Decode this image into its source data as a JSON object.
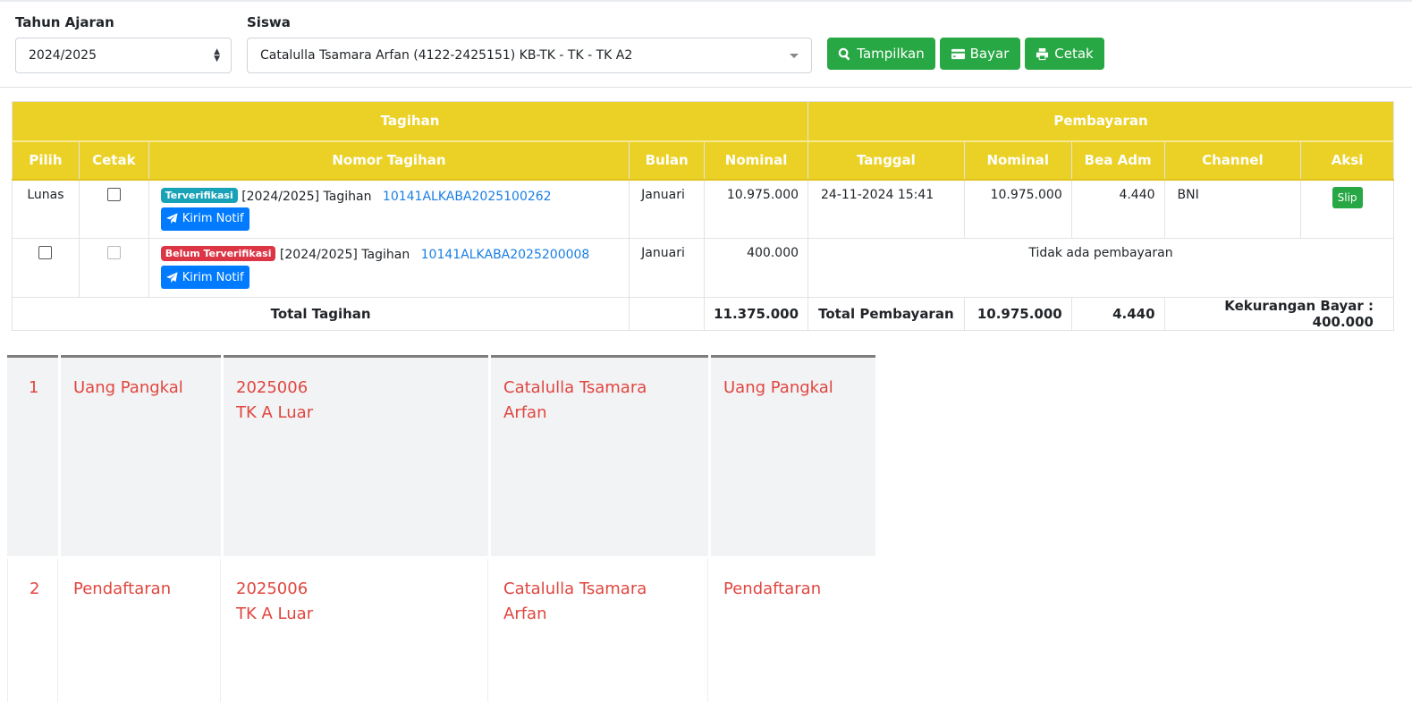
{
  "filter": {
    "year_label": "Tahun Ajaran",
    "year_value": "2024/2025",
    "student_label": "Siswa",
    "student_value": "Catalulla Tsamara Arfan (4122-2425151) KB-TK - TK - TK A2",
    "buttons": {
      "show": "Tampilkan",
      "pay": "Bayar",
      "print": "Cetak"
    }
  },
  "table": {
    "group_headers": {
      "billing": "Tagihan",
      "payment": "Pembayaran"
    },
    "columns": [
      "Pilih",
      "Cetak",
      "Nomor Tagihan",
      "Bulan",
      "Nominal",
      "Tanggal",
      "Nominal",
      "Bea Adm",
      "Channel",
      "Aksi"
    ],
    "rows": [
      {
        "pilih": "Lunas",
        "badge": "Terverifikasi",
        "desc": "[2024/2025] Tagihan",
        "number": "10141ALKABA2025100262",
        "notify": "Kirim Notif",
        "month": "Januari",
        "nominal": "10.975.000",
        "date": "24-11-2024 15:41",
        "paid": "10.975.000",
        "fee": "4.440",
        "channel": "BNI",
        "action": "Slip"
      },
      {
        "badge": "Belum Terverifikasi",
        "desc": "[2024/2025] Tagihan",
        "number": "10141ALKABA2025200008",
        "notify": "Kirim Notif",
        "month": "Januari",
        "nominal": "400.000",
        "no_payment": "Tidak ada pembayaran"
      }
    ],
    "totals": {
      "bill_label": "Total Tagihan",
      "bill_total": "11.375.000",
      "pay_label": "Total Pembayaran",
      "pay_total": "10.975.000",
      "fee_total": "4.440",
      "shortfall": "Kekurangan Bayar : 400.000"
    }
  },
  "detail_rows": [
    {
      "no": "1",
      "type": "Uang Pangkal",
      "code": "2025006",
      "class": "TK A Luar",
      "name_1": "Catalulla Tsamara",
      "name_2": "Arfan",
      "desc": "Uang Pangkal"
    },
    {
      "no": "2",
      "type": "Pendaftaran",
      "code": "2025006",
      "class": "TK A Luar",
      "name_1": "Catalulla Tsamara",
      "name_2": "Arfan",
      "desc": "Pendaftaran"
    }
  ],
  "colors": {
    "header_yellow": "#ebd125",
    "green": "#28a745",
    "blue": "#007bff",
    "info": "#17a2b8",
    "danger": "#dc3545",
    "detail_text": "#e0463f"
  },
  "icons": [
    "search-icon",
    "credit-card-icon",
    "print-icon",
    "paper-plane-icon",
    "sort-arrows-icon",
    "caret-down-icon"
  ]
}
